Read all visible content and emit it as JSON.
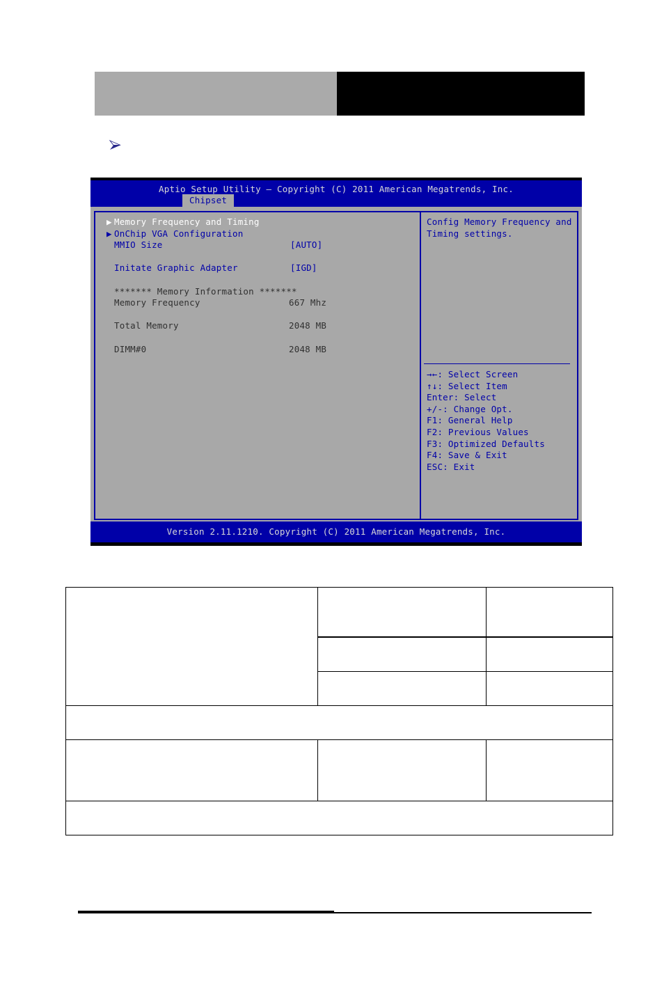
{
  "page": {
    "header_banner": {
      "left_block_color": "#aaaaaa",
      "right_block_color": "#000000"
    },
    "bullet_icon": "arrow-bullet-icon"
  },
  "bios": {
    "title": "Aptio Setup Utility – Copyright (C) 2011 American Megatrends, Inc.",
    "tab": "Chipset",
    "footer": "Version 2.11.1210. Copyright (C) 2011 American Megatrends, Inc.",
    "menu": [
      {
        "kind": "submenu",
        "label": "Memory Frequency and Timing",
        "value": "",
        "selected": true
      },
      {
        "kind": "submenu",
        "label": "OnChip VGA Configuration",
        "value": "",
        "selected": false
      },
      {
        "kind": "option",
        "label": "MMIO Size",
        "value": "[AUTO]",
        "selected": false
      },
      {
        "kind": "blank",
        "label": "",
        "value": "",
        "selected": false
      },
      {
        "kind": "option",
        "label": "Initate Graphic Adapter",
        "value": "[IGD]",
        "selected": false
      },
      {
        "kind": "blank",
        "label": "",
        "value": "",
        "selected": false
      },
      {
        "kind": "header",
        "label": "******* Memory Information *******",
        "value": "",
        "selected": false
      },
      {
        "kind": "info",
        "label": "Memory Frequency",
        "value": "667 Mhz",
        "selected": false
      },
      {
        "kind": "blank",
        "label": "",
        "value": "",
        "selected": false
      },
      {
        "kind": "info",
        "label": "Total Memory",
        "value": "2048 MB",
        "selected": false
      },
      {
        "kind": "blank",
        "label": "",
        "value": "",
        "selected": false
      },
      {
        "kind": "info",
        "label": "DIMM#0",
        "value": "2048 MB",
        "selected": false
      }
    ],
    "help": {
      "line1": "Config Memory Frequency and",
      "line2": "Timing settings."
    },
    "keys": [
      "→←: Select Screen",
      "↑↓: Select Item",
      "Enter: Select",
      "+/-: Change Opt.",
      "F1: General Help",
      "F2: Previous Values",
      "F3: Optimized Defaults",
      "F4: Save & Exit",
      "ESC: Exit"
    ],
    "colors": {
      "chrome_blue": "#0000a8",
      "panel_gray": "#a8a8a8",
      "title_text": "#d8d8d8",
      "selected_text": "#ffffff",
      "info_text": "#303030"
    }
  },
  "spec_table": {
    "rows": [
      {
        "cells": [
          {
            "text": "",
            "rowspan": 3
          },
          {
            "text": ""
          },
          {
            "text": ""
          }
        ]
      },
      {
        "cells": [
          {
            "text": ""
          },
          {
            "text": ""
          }
        ]
      },
      {
        "cells": [
          {
            "text": ""
          },
          {
            "text": ""
          }
        ]
      },
      {
        "cells": [
          {
            "text": "",
            "colspan": 3
          }
        ]
      },
      {
        "cells": [
          {
            "text": ""
          },
          {
            "text": ""
          },
          {
            "text": ""
          }
        ]
      },
      {
        "cells": [
          {
            "text": "",
            "colspan": 3
          }
        ]
      }
    ]
  }
}
